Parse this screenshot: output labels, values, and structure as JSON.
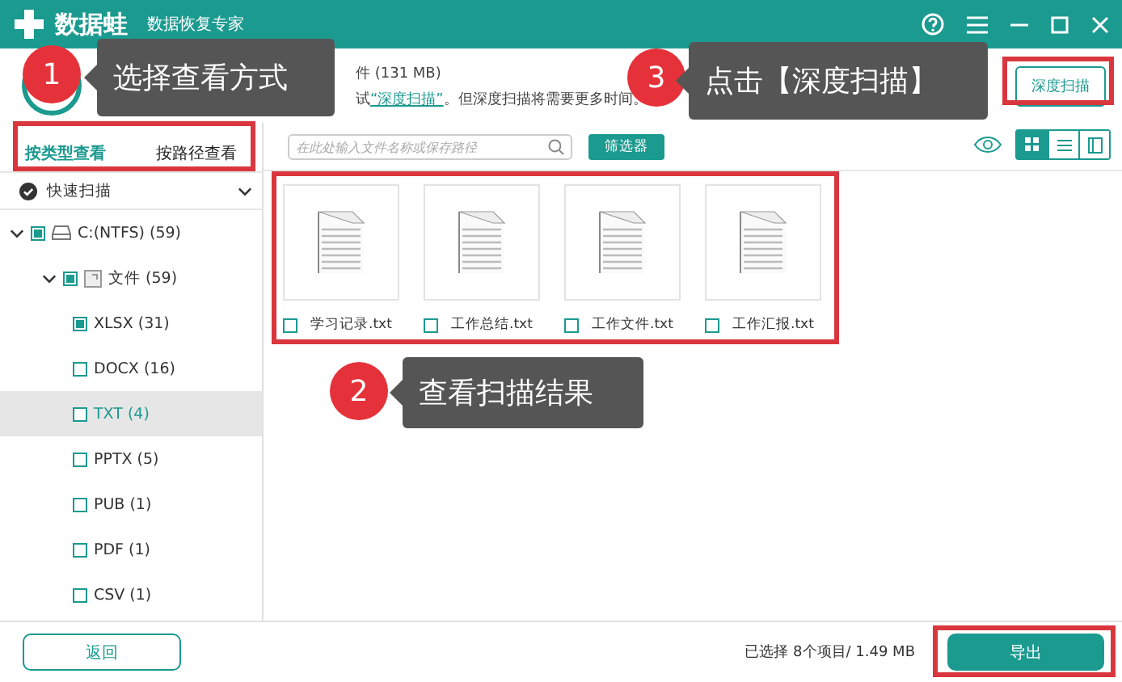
{
  "window": {
    "app_name": "数据蛙",
    "subtitle": "数据恢复专家",
    "controls": [
      {
        "kind": "help"
      },
      {
        "kind": "menu"
      },
      {
        "kind": "minimize"
      },
      {
        "kind": "maximize"
      },
      {
        "kind": "close"
      }
    ]
  },
  "header": {
    "size_text": "件 (131 MB)",
    "hint_prefix": "试",
    "hint_link": "“深度扫描”",
    "hint_suffix": "。但深度扫描将需要更多时间。",
    "deep_scan_button": "深度扫描"
  },
  "view_tabs": [
    {
      "label": "按类型查看",
      "selected": true
    },
    {
      "label": "按路径查看",
      "selected": false
    }
  ],
  "scan_mode": {
    "label": "快速扫描",
    "checked": true
  },
  "tree": [
    {
      "label": "C:(NTFS) (59)",
      "kind": "drive",
      "checked": true,
      "expanded": true,
      "selected": false,
      "children": [
        {
          "label": "文件 (59)",
          "kind": "folder",
          "checked": true,
          "expanded": true,
          "selected": false,
          "children": [
            {
              "label": "XLSX (31)",
              "checked": true,
              "selected": false
            },
            {
              "label": "DOCX (16)",
              "checked": false,
              "selected": false
            },
            {
              "label": "TXT (4)",
              "checked": false,
              "selected": true
            },
            {
              "label": "PPTX (5)",
              "checked": false,
              "selected": false
            },
            {
              "label": "PUB (1)",
              "checked": false,
              "selected": false
            },
            {
              "label": "PDF (1)",
              "checked": false,
              "selected": false
            },
            {
              "label": "CSV (1)",
              "checked": false,
              "selected": false
            }
          ]
        }
      ]
    }
  ],
  "toolbar": {
    "search_placeholder": "在此处输入文件名称或保存路径",
    "filter_button": "筛选器",
    "views": [
      {
        "kind": "grid",
        "selected": true
      },
      {
        "kind": "list",
        "selected": false
      },
      {
        "kind": "detail",
        "selected": false
      }
    ]
  },
  "files": [
    {
      "name": "学习记录.txt",
      "checked": false
    },
    {
      "name": "工作总结.txt",
      "checked": false
    },
    {
      "name": "工作文件.txt",
      "checked": false
    },
    {
      "name": "工作汇报.txt",
      "checked": false
    }
  ],
  "footer": {
    "back_button": "返回",
    "selection_summary": "已选择 8个项目/ 1.49 MB",
    "export_button": "导出"
  },
  "annotations": [
    {
      "number": "1",
      "text": "选择查看方式"
    },
    {
      "number": "2",
      "text": "查看扫描结果"
    },
    {
      "number": "3",
      "text": "点击【深度扫描】"
    }
  ]
}
